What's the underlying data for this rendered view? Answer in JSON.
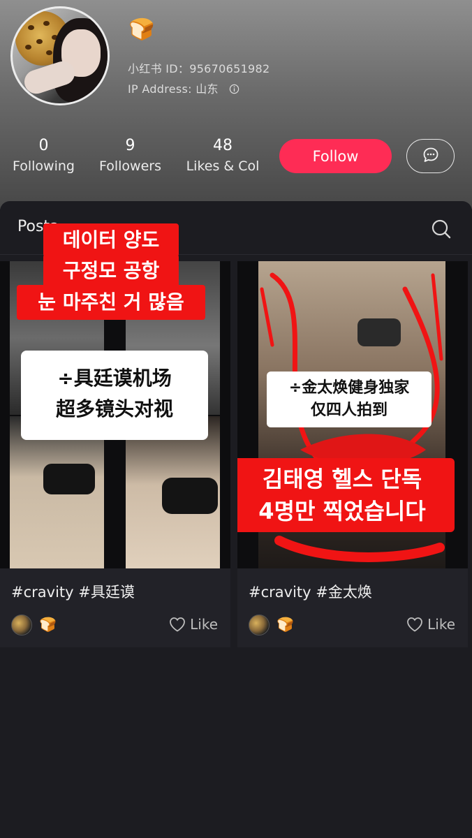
{
  "profile": {
    "badge_emoji": "🍞",
    "xhs_id": "小红书 ID：95670651982",
    "ip_address": "IP Address: 山东",
    "ip_info_icon": "info-circle-icon"
  },
  "stats": [
    {
      "value": "0",
      "label": "Following"
    },
    {
      "value": "9",
      "label": "Followers"
    },
    {
      "value": "48",
      "label": "Likes & Col"
    }
  ],
  "actions": {
    "follow_label": "Follow",
    "message_icon": "chat-bubble-icon"
  },
  "tabs": {
    "posts_label": "Posts",
    "search_icon": "search-icon"
  },
  "overlay_banner": {
    "line1": "데이터 양도",
    "line2": "구정모 공항",
    "line3": "눈 마주친 거 많음"
  },
  "posts": [
    {
      "thumb_text_cn_1": "÷具廷谟机场",
      "thumb_text_cn_2": "超多镜头对视",
      "caption": "#cravity #具廷谟",
      "author_emoji": "🍞",
      "like_label": "Like"
    },
    {
      "thumb_text_cn_1": "÷金太焕健身独家",
      "thumb_text_cn_2": "仅四人拍到",
      "thumb_text_kr_1": "김태영 헬스 단독",
      "thumb_text_kr_2": "4명만 찍었습니다",
      "caption": "#cravity #金太焕",
      "author_emoji": "🍞",
      "like_label": "Like"
    }
  ],
  "colors": {
    "follow": "#fe2c55",
    "panel": "#1c1c21",
    "red_overlay": "#f01414"
  }
}
